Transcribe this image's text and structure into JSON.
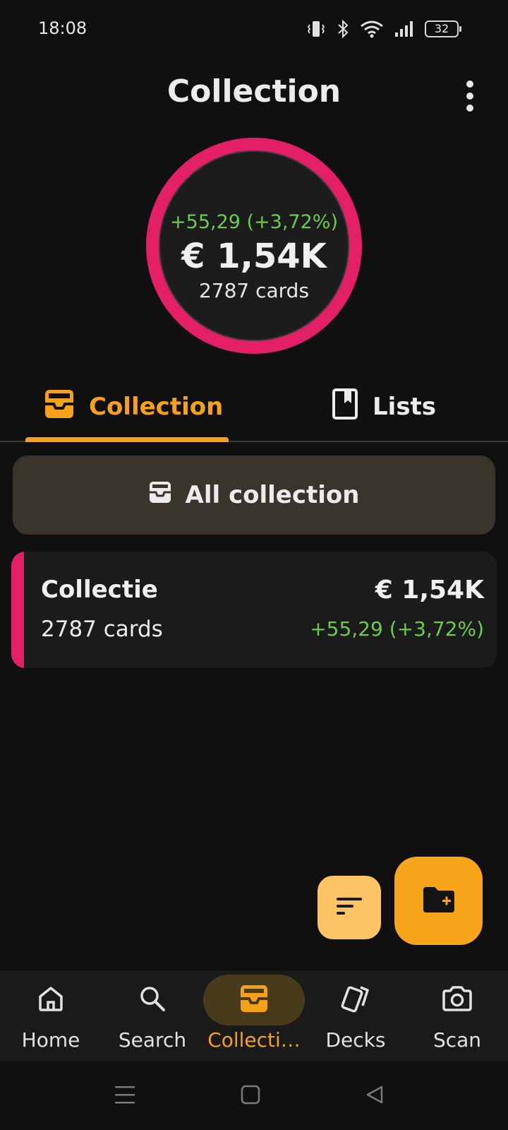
{
  "status_bar": {
    "time": "18:08",
    "battery": "32",
    "icons": [
      "vibrate-icon",
      "bluetooth-icon",
      "wifi-icon",
      "signal-icon",
      "battery-icon"
    ]
  },
  "header": {
    "title": "Collection",
    "menu_icon": "more-vertical-icon"
  },
  "summary": {
    "change": "+55,29 (+3,72%)",
    "value": "€ 1,54K",
    "count": "2787 cards",
    "ring_color": "#e31f67"
  },
  "tabs": [
    {
      "label": "Collection",
      "icon": "inbox-icon",
      "active": true
    },
    {
      "label": "Lists",
      "icon": "bookmark-icon",
      "active": false
    }
  ],
  "all_collection": {
    "label": "All collection",
    "icon": "inbox-icon"
  },
  "collections": [
    {
      "name": "Collectie",
      "count": "2787 cards",
      "value": "€ 1,54K",
      "change": "+55,29 (+3,72%)",
      "accent": "#e31f67"
    }
  ],
  "fabs": {
    "sort_icon": "sort-icon",
    "add_icon": "add-folder-icon"
  },
  "bottom_nav": [
    {
      "label": "Home",
      "icon": "home-icon",
      "active": false
    },
    {
      "label": "Search",
      "icon": "search-icon",
      "active": false
    },
    {
      "label": "Collecti…",
      "icon": "inbox-icon",
      "active": true
    },
    {
      "label": "Decks",
      "icon": "cards-icon",
      "active": false
    },
    {
      "label": "Scan",
      "icon": "camera-icon",
      "active": false
    }
  ],
  "colors": {
    "accent": "#f5a21b",
    "positive": "#6ccb4a",
    "background": "#101010"
  }
}
